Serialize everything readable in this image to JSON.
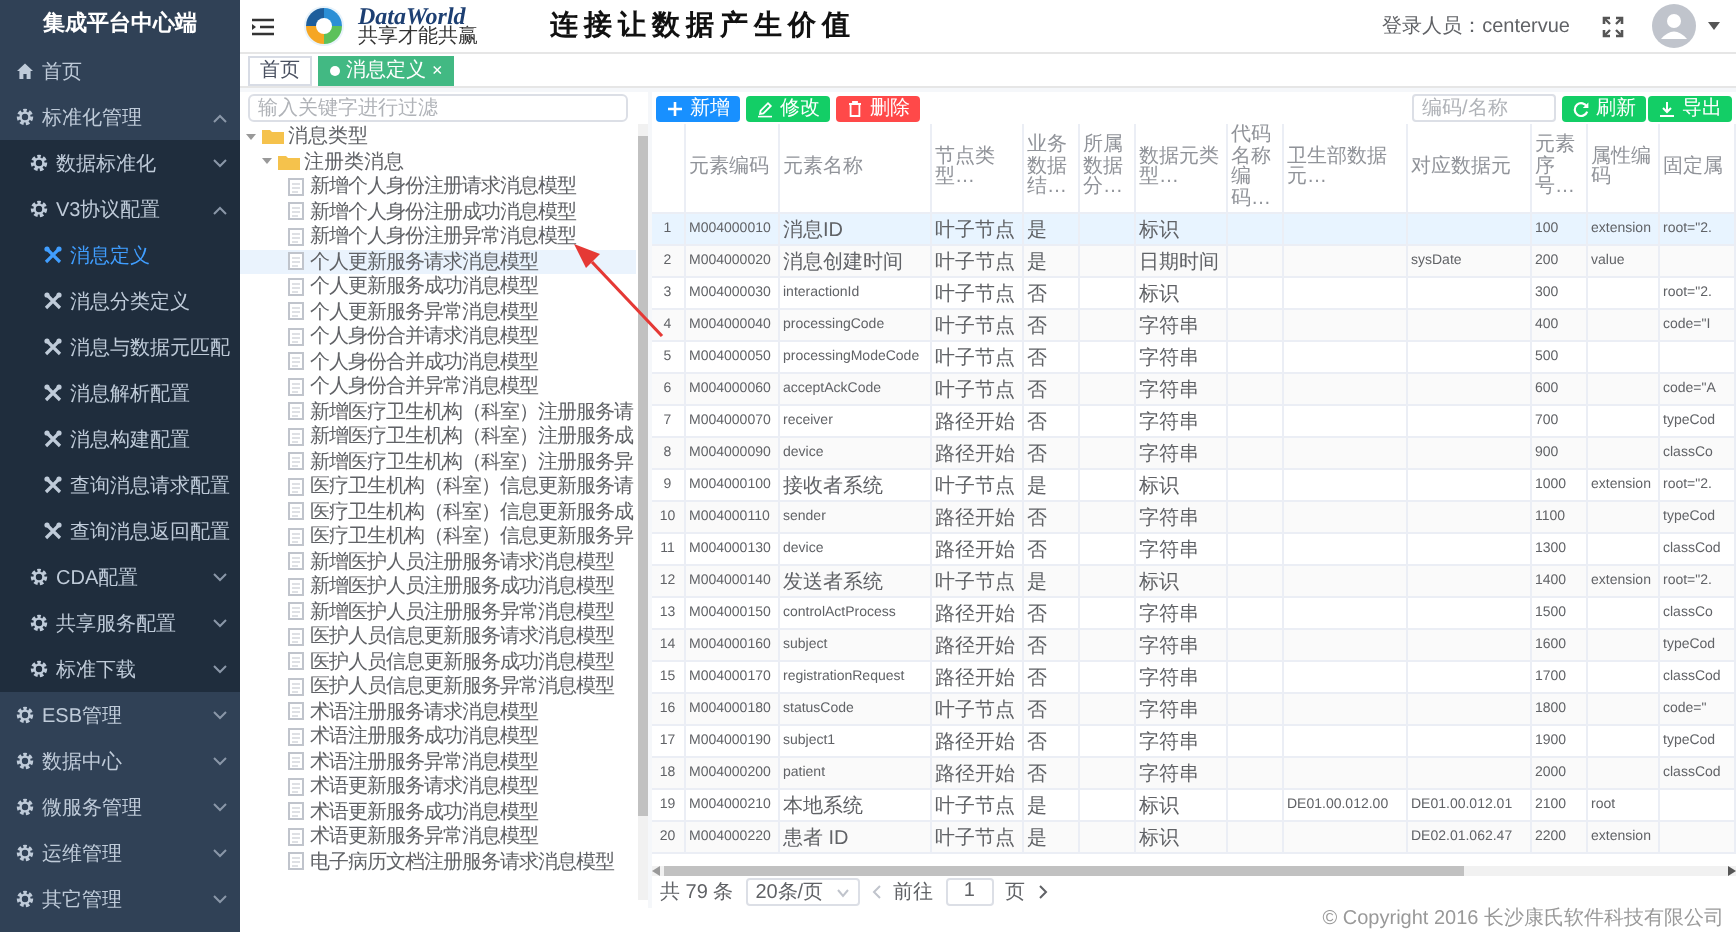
{
  "header": {
    "logo_text": "DataWorld",
    "logo_subtitle": "共享才能共赢",
    "slogan": "连接让数据产生价值",
    "user_label": "登录人员：centervue"
  },
  "sidebar": {
    "title": "集成平台中心端",
    "items": [
      {
        "label": "首页",
        "kind": "page",
        "selected": false
      },
      {
        "label": "标准化管理",
        "kind": "group",
        "expanded": true,
        "children": [
          {
            "label": "数据标准化",
            "kind": "group",
            "expanded": false
          },
          {
            "label": "V3协议配置",
            "kind": "group",
            "expanded": true,
            "children": [
              {
                "label": "消息定义",
                "kind": "leaf",
                "selected": true
              },
              {
                "label": "消息分类定义",
                "kind": "leaf",
                "selected": false
              },
              {
                "label": "消息与数据元匹配",
                "kind": "leaf",
                "selected": false
              },
              {
                "label": "消息解析配置",
                "kind": "leaf",
                "selected": false
              },
              {
                "label": "消息构建配置",
                "kind": "leaf",
                "selected": false
              },
              {
                "label": "查询消息请求配置",
                "kind": "leaf",
                "selected": false
              },
              {
                "label": "查询消息返回配置",
                "kind": "leaf",
                "selected": false
              }
            ]
          },
          {
            "label": "CDA配置",
            "kind": "group",
            "expanded": false
          },
          {
            "label": "共享服务配置",
            "kind": "group",
            "expanded": false
          },
          {
            "label": "标准下载",
            "kind": "group",
            "expanded": false
          }
        ]
      },
      {
        "label": "ESB管理",
        "kind": "group",
        "expanded": false
      },
      {
        "label": "数据中心",
        "kind": "group",
        "expanded": false
      },
      {
        "label": "微服务管理",
        "kind": "group",
        "expanded": false
      },
      {
        "label": "运维管理",
        "kind": "group",
        "expanded": false
      },
      {
        "label": "其它管理",
        "kind": "group",
        "expanded": false
      }
    ]
  },
  "tabs": [
    {
      "label": "首页",
      "selected": false
    },
    {
      "label": "消息定义",
      "selected": true,
      "close": "×"
    }
  ],
  "tree": {
    "placeholder": "输入关键字进行过滤",
    "nodes": [
      {
        "label": "消息类型",
        "expanded": true,
        "children": [
          {
            "label": "注册类消息",
            "expanded": true,
            "children": [
              {
                "label": "新增个人身份注册请求消息模型",
                "selected": false
              },
              {
                "label": "新增个人身份注册成功消息模型",
                "selected": false
              },
              {
                "label": "新增个人身份注册异常消息模型",
                "selected": false
              },
              {
                "label": "个人更新服务请求消息模型",
                "selected": true
              },
              {
                "label": "个人更新服务成功消息模型",
                "selected": false
              },
              {
                "label": "个人更新服务异常消息模型",
                "selected": false
              },
              {
                "label": "个人身份合并请求消息模型",
                "selected": false
              },
              {
                "label": "个人身份合并成功消息模型",
                "selected": false
              },
              {
                "label": "个人身份合并异常消息模型",
                "selected": false
              },
              {
                "label": "新增医疗卫生机构（科室）注册服务请",
                "selected": false
              },
              {
                "label": "新增医疗卫生机构（科室）注册服务成",
                "selected": false
              },
              {
                "label": "新增医疗卫生机构（科室）注册服务异",
                "selected": false
              },
              {
                "label": "医疗卫生机构（科室）信息更新服务请",
                "selected": false
              },
              {
                "label": "医疗卫生机构（科室）信息更新服务成",
                "selected": false
              },
              {
                "label": "医疗卫生机构（科室）信息更新服务异",
                "selected": false
              },
              {
                "label": "新增医护人员注册服务请求消息模型",
                "selected": false
              },
              {
                "label": "新增医护人员注册服务成功消息模型",
                "selected": false
              },
              {
                "label": "新增医护人员注册服务异常消息模型",
                "selected": false
              },
              {
                "label": "医护人员信息更新服务请求消息模型",
                "selected": false
              },
              {
                "label": "医护人员信息更新服务成功消息模型",
                "selected": false
              },
              {
                "label": "医护人员信息更新服务异常消息模型",
                "selected": false
              },
              {
                "label": "术语注册服务请求消息模型",
                "selected": false
              },
              {
                "label": "术语注册服务成功消息模型",
                "selected": false
              },
              {
                "label": "术语注册服务异常消息模型",
                "selected": false
              },
              {
                "label": "术语更新服务请求消息模型",
                "selected": false
              },
              {
                "label": "术语更新服务成功消息模型",
                "selected": false
              },
              {
                "label": "术语更新服务异常消息模型",
                "selected": false
              },
              {
                "label": "电子病历文档注册服务请求消息模型",
                "selected": false
              }
            ]
          }
        ]
      }
    ]
  },
  "toolbar": {
    "buttons": [
      {
        "label": "新增",
        "kind": "add"
      },
      {
        "label": "修改",
        "kind": "edit"
      },
      {
        "label": "删除",
        "kind": "delete"
      }
    ],
    "search": {
      "placeholder": "编码/名称"
    },
    "right_buttons": [
      {
        "label": "刷新",
        "kind": "refresh"
      },
      {
        "label": "导出",
        "kind": "export"
      }
    ]
  },
  "table": {
    "columns": [
      "元素编码",
      "元素名称",
      "节点类型…",
      "业务数据结…",
      "所属数据分…",
      "数据元类型…",
      "代码名称编码…",
      "卫生部数据元…",
      "对应数据元",
      "元素序号…",
      "属性编码",
      "固定属"
    ],
    "rows": [
      {
        "index": "1",
        "selected": true,
        "cells": [
          "M004000010",
          "消息ID",
          "叶子节点",
          "是",
          null,
          "标识",
          null,
          null,
          null,
          "100",
          "extension",
          "root=\"2."
        ]
      },
      {
        "index": "2",
        "selected": false,
        "cells": [
          "M004000020",
          "消息创建时间",
          "叶子节点",
          "是",
          null,
          "日期时间",
          null,
          null,
          "sysDate",
          "200",
          "value",
          null
        ]
      },
      {
        "index": "3",
        "selected": false,
        "cells": [
          "M004000030",
          "interactionId",
          "叶子节点",
          "否",
          null,
          "标识",
          null,
          null,
          null,
          "300",
          null,
          "root=\"2."
        ]
      },
      {
        "index": "4",
        "selected": false,
        "cells": [
          "M004000040",
          "processingCode",
          "叶子节点",
          "否",
          null,
          "字符串",
          null,
          null,
          null,
          "400",
          null,
          "code=\"I"
        ]
      },
      {
        "index": "5",
        "selected": false,
        "cells": [
          "M004000050",
          "processingModeCode",
          "叶子节点",
          "否",
          null,
          "字符串",
          null,
          null,
          null,
          "500",
          null,
          null
        ]
      },
      {
        "index": "6",
        "selected": false,
        "cells": [
          "M004000060",
          "acceptAckCode",
          "叶子节点",
          "否",
          null,
          "字符串",
          null,
          null,
          null,
          "600",
          null,
          "code=\"A"
        ]
      },
      {
        "index": "7",
        "selected": false,
        "cells": [
          "M004000070",
          "receiver",
          "路径开始",
          "否",
          null,
          "字符串",
          null,
          null,
          null,
          "700",
          null,
          "typeCod"
        ]
      },
      {
        "index": "8",
        "selected": false,
        "cells": [
          "M004000090",
          "device",
          "路径开始",
          "否",
          null,
          "字符串",
          null,
          null,
          null,
          "900",
          null,
          "classCo"
        ]
      },
      {
        "index": "9",
        "selected": false,
        "cells": [
          "M004000100",
          "接收者系统",
          "叶子节点",
          "是",
          null,
          "标识",
          null,
          null,
          null,
          "1000",
          "extension",
          "root=\"2."
        ]
      },
      {
        "index": "10",
        "selected": false,
        "cells": [
          "M004000110",
          "sender",
          "路径开始",
          "否",
          null,
          "字符串",
          null,
          null,
          null,
          "1100",
          null,
          "typeCod"
        ]
      },
      {
        "index": "11",
        "selected": false,
        "cells": [
          "M004000130",
          "device",
          "路径开始",
          "否",
          null,
          "字符串",
          null,
          null,
          null,
          "1300",
          null,
          "classCod"
        ]
      },
      {
        "index": "12",
        "selected": false,
        "cells": [
          "M004000140",
          "发送者系统",
          "叶子节点",
          "是",
          null,
          "标识",
          null,
          null,
          null,
          "1400",
          "extension",
          "root=\"2."
        ]
      },
      {
        "index": "13",
        "selected": false,
        "cells": [
          "M004000150",
          "controlActProcess",
          "路径开始",
          "否",
          null,
          "字符串",
          null,
          null,
          null,
          "1500",
          null,
          "classCo"
        ]
      },
      {
        "index": "14",
        "selected": false,
        "cells": [
          "M004000160",
          "subject",
          "路径开始",
          "否",
          null,
          "字符串",
          null,
          null,
          null,
          "1600",
          null,
          "typeCod"
        ]
      },
      {
        "index": "15",
        "selected": false,
        "cells": [
          "M004000170",
          "registrationRequest",
          "路径开始",
          "否",
          null,
          "字符串",
          null,
          null,
          null,
          "1700",
          null,
          "classCod"
        ]
      },
      {
        "index": "16",
        "selected": false,
        "cells": [
          "M004000180",
          "statusCode",
          "叶子节点",
          "否",
          null,
          "字符串",
          null,
          null,
          null,
          "1800",
          null,
          "code=\""
        ]
      },
      {
        "index": "17",
        "selected": false,
        "cells": [
          "M004000190",
          "subject1",
          "路径开始",
          "否",
          null,
          "字符串",
          null,
          null,
          null,
          "1900",
          null,
          "typeCod"
        ]
      },
      {
        "index": "18",
        "selected": false,
        "cells": [
          "M004000200",
          "patient",
          "路径开始",
          "否",
          null,
          "字符串",
          null,
          null,
          null,
          "2000",
          null,
          "classCod"
        ]
      },
      {
        "index": "19",
        "selected": false,
        "cells": [
          "M004000210",
          "本地系统",
          "叶子节点",
          "是",
          null,
          "标识",
          null,
          "DE01.00.012.00",
          "DE01.00.012.01",
          "2100",
          "root",
          null
        ]
      },
      {
        "index": "20",
        "selected": false,
        "cells": [
          "M004000220",
          "患者 ID",
          "叶子节点",
          "是",
          null,
          "标识",
          null,
          null,
          "DE02.01.062.47",
          "2200",
          "extension",
          null
        ]
      }
    ]
  },
  "pagination": {
    "total": "共 79 条",
    "page_size": "20条/页",
    "goto_label": "前往",
    "page": "1",
    "page_unit": "页"
  },
  "footer": {
    "copyright": "© Copyright 2016 长沙康氏软件科技有限公司"
  },
  "annotation": {
    "kind": "arrow"
  }
}
